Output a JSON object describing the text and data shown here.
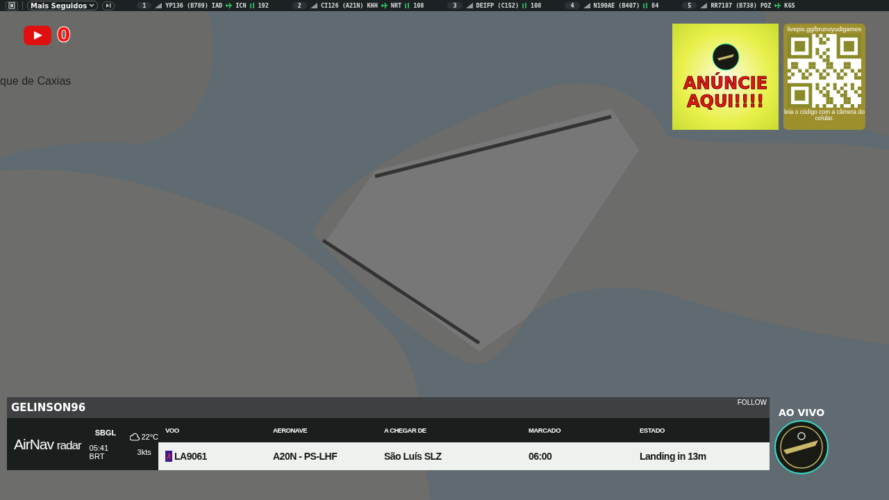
{
  "top_bar": {
    "dropdown": {
      "label": "Mais Seguidos"
    },
    "flights": [
      {
        "rank": "1",
        "callsign": "YP136 (B789)",
        "from": "IAD",
        "to": "ICN",
        "count": "192"
      },
      {
        "rank": "2",
        "callsign": "CI126 (A21N)",
        "from": "KHH",
        "to": "NRT",
        "count": "108"
      },
      {
        "rank": "3",
        "callsign": "DEIFP (C152)",
        "count": "108"
      },
      {
        "rank": "4",
        "callsign": "N190AE (B407)",
        "count": "84"
      },
      {
        "rank": "5",
        "callsign": "RR7187 (B738)",
        "from": "POZ",
        "to": "KGS"
      }
    ]
  },
  "map": {
    "place_label": "que de Caxias"
  },
  "subscriber_counter": {
    "count": "0"
  },
  "ad": {
    "headline": "ANÚNCIE AQUI!!!!"
  },
  "qr_card": {
    "url": "livepix.gg/brunoyudigames",
    "caption": "leia o código com a câmera do celular."
  },
  "flight_panel": {
    "user": "GELINSON96",
    "follow": "FOLLOW",
    "brand": "AirNav",
    "brand_suffix": "radar",
    "airport": "SBGL",
    "time": "05:41 BRT",
    "temperature": "22°C",
    "wind": "3kts",
    "columns": [
      "VOO",
      "AERONAVE",
      "A CHEGAR DE",
      "MARCADO",
      "ESTADO"
    ],
    "row": [
      "LA9061",
      "A20N - PS-LHF",
      "São Luís SLZ",
      "06:00",
      "Landing in 13m"
    ]
  },
  "live": {
    "label": "AO VIVO"
  }
}
